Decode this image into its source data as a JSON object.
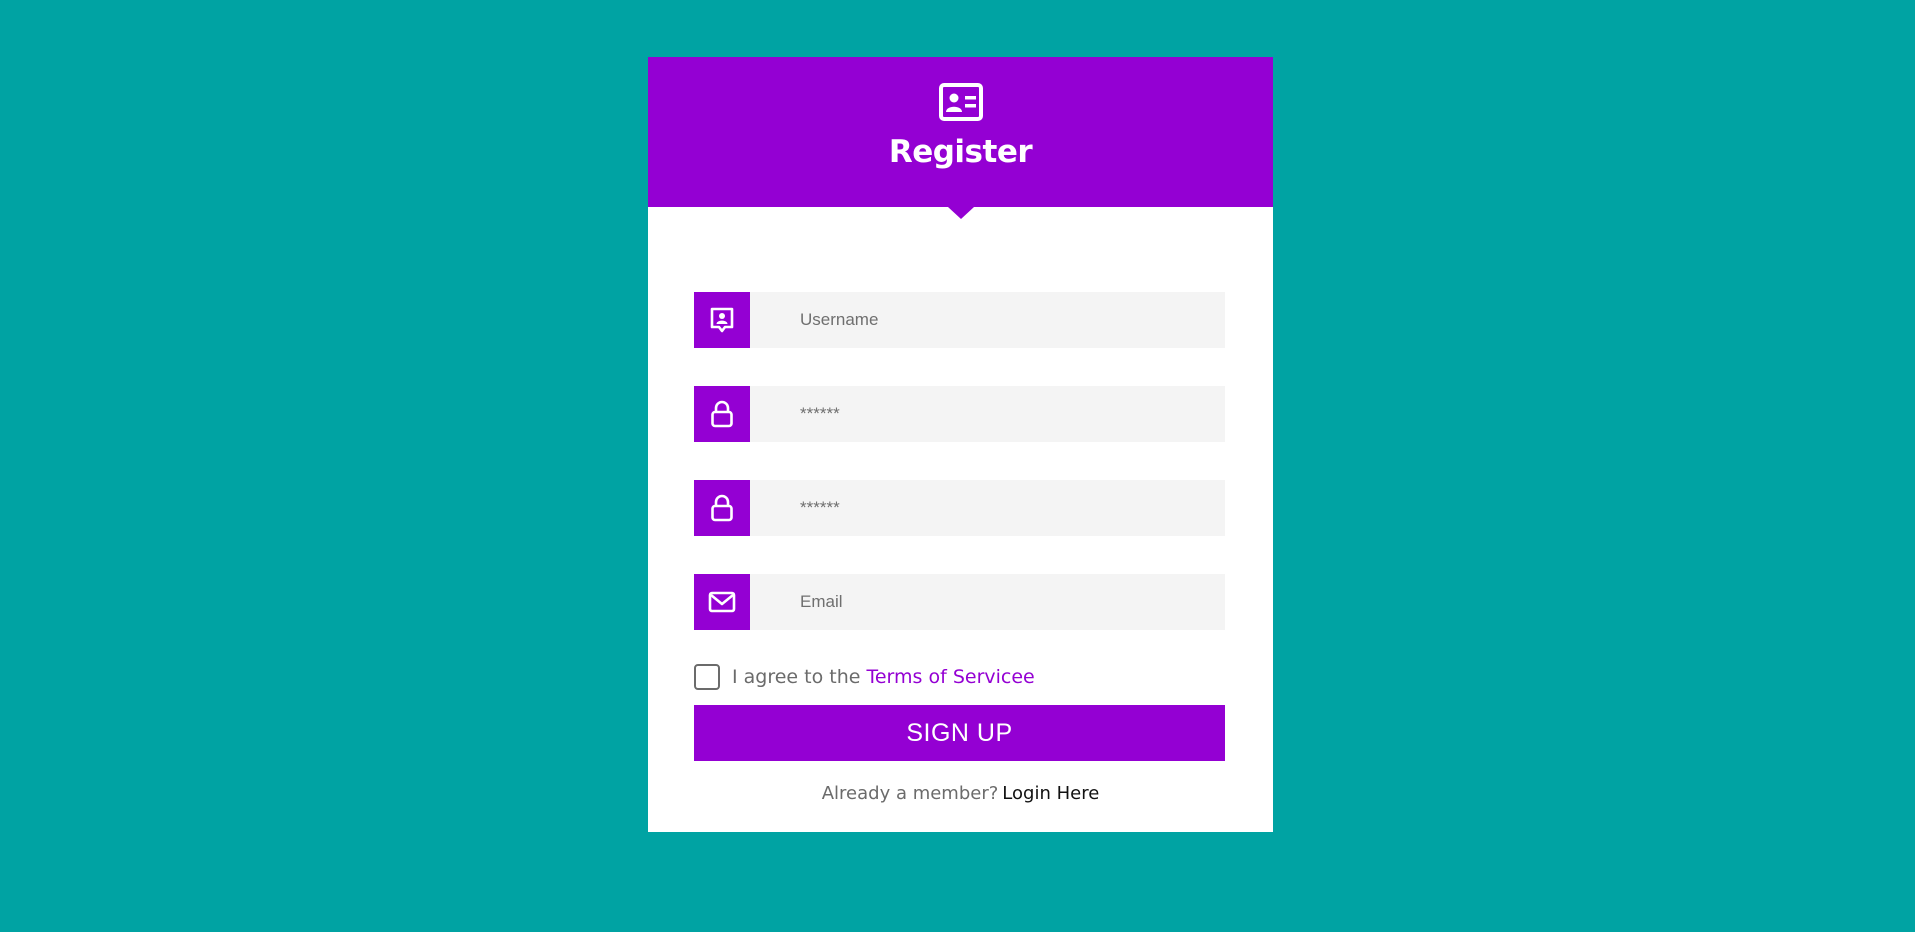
{
  "colors": {
    "background": "#00A3A3",
    "accent": "#9400D3",
    "field_bg": "#F4F4F4"
  },
  "header": {
    "icon": "id-card-icon",
    "title": "Register"
  },
  "fields": [
    {
      "icon": "user-badge-icon",
      "placeholder": "Username",
      "type": "text"
    },
    {
      "icon": "lock-icon",
      "placeholder": "******",
      "type": "password"
    },
    {
      "icon": "lock-icon",
      "placeholder": "******",
      "type": "password"
    },
    {
      "icon": "envelope-icon",
      "placeholder": "Email",
      "type": "email"
    }
  ],
  "terms": {
    "checked": false,
    "text": "I agree to the",
    "link": "Terms of Servicee"
  },
  "signup_label": "SIGN UP",
  "footer": {
    "text": "Already a member?",
    "link": "Login Here"
  }
}
